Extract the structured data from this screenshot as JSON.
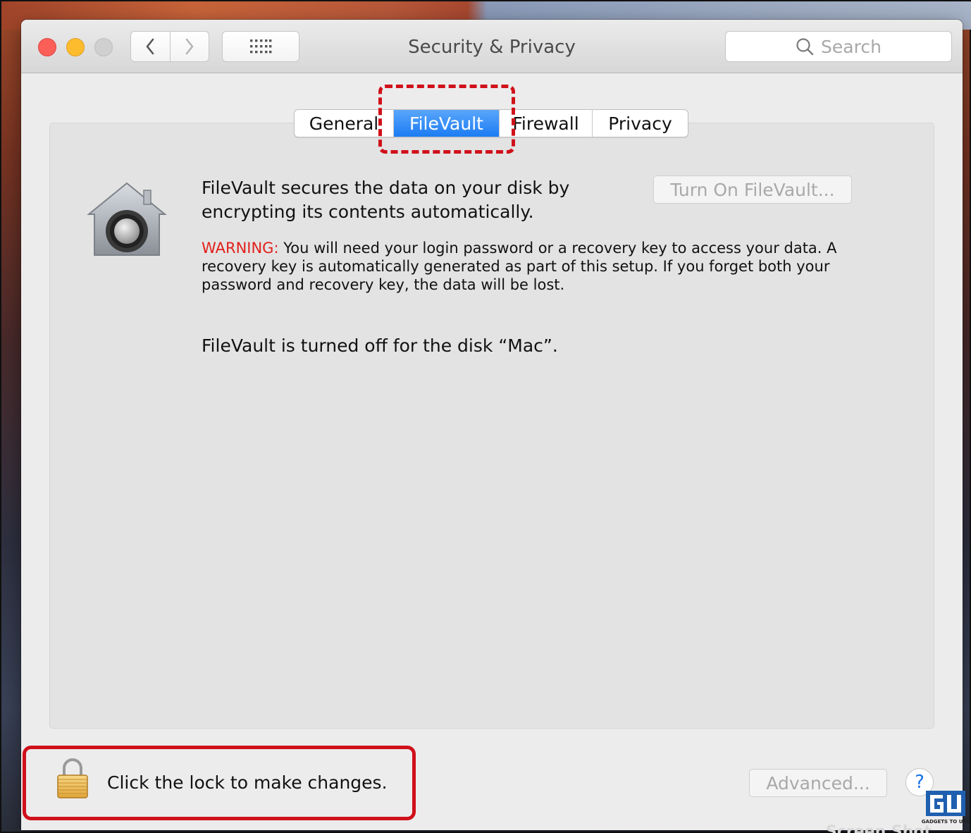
{
  "window": {
    "title": "Security & Privacy",
    "search_placeholder": "Search"
  },
  "toolbar": {
    "back_icon": "chevron-left-icon",
    "forward_icon": "chevron-right-icon",
    "grid_icon": "show-all-grid-icon"
  },
  "tabs": [
    {
      "label": "General",
      "active": false
    },
    {
      "label": "FileVault",
      "active": true
    },
    {
      "label": "Firewall",
      "active": false
    },
    {
      "label": "Privacy",
      "active": false
    }
  ],
  "filevault": {
    "description_line1": "FileVault secures the data on your disk by",
    "description_line2": "encrypting its contents automatically.",
    "turn_on_button": "Turn On FileVault...",
    "warning_label": "WARNING:",
    "warning_line1": " You will need your login password or a recovery key to access your data. A",
    "warning_line2": "recovery key is automatically generated as part of this setup. If you forget both your",
    "warning_line3": "password and recovery key, the data will be lost.",
    "status": "FileVault is turned off for the disk “Mac”."
  },
  "footer": {
    "lock_text": "Click the lock to make changes.",
    "advanced_button": "Advanced...",
    "help_button": "?"
  },
  "overlay": {
    "watermark_text": "GADGETS TO USE",
    "screen_shot_label": "Screen Shot"
  },
  "colors": {
    "accent": "#1c7cf3",
    "warning": "#e1201b",
    "highlight": "#d0101a"
  }
}
